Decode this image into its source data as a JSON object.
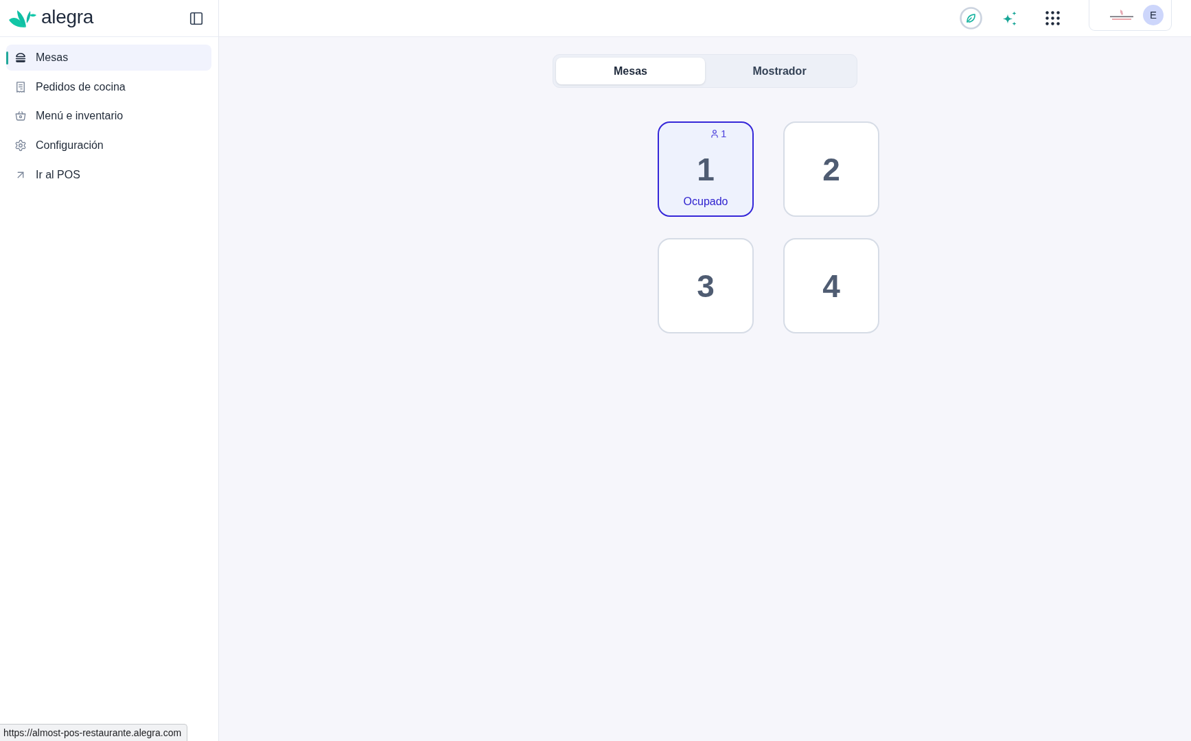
{
  "sidebar": {
    "logo": "alegra",
    "items": [
      {
        "label": "Mesas",
        "selected": true
      },
      {
        "label": "Pedidos de cocina",
        "selected": false
      },
      {
        "label": "Menú e inventario",
        "selected": false
      },
      {
        "label": "Configuración",
        "selected": false
      },
      {
        "label": "Ir al POS",
        "selected": false
      }
    ]
  },
  "header": {
    "account": {
      "avatar_initial": "E"
    }
  },
  "tabs": [
    {
      "label": "Mesas",
      "selected": true
    },
    {
      "label": "Mostrador",
      "selected": false
    }
  ],
  "tables": [
    {
      "number": "1",
      "occupied": true,
      "guests": "1",
      "status": "Ocupado"
    },
    {
      "number": "2",
      "occupied": false
    },
    {
      "number": "3",
      "occupied": false
    },
    {
      "number": "4",
      "occupied": false
    }
  ],
  "status_bar": {
    "url": "https://almost-pos-restaurante.alegra.com"
  }
}
